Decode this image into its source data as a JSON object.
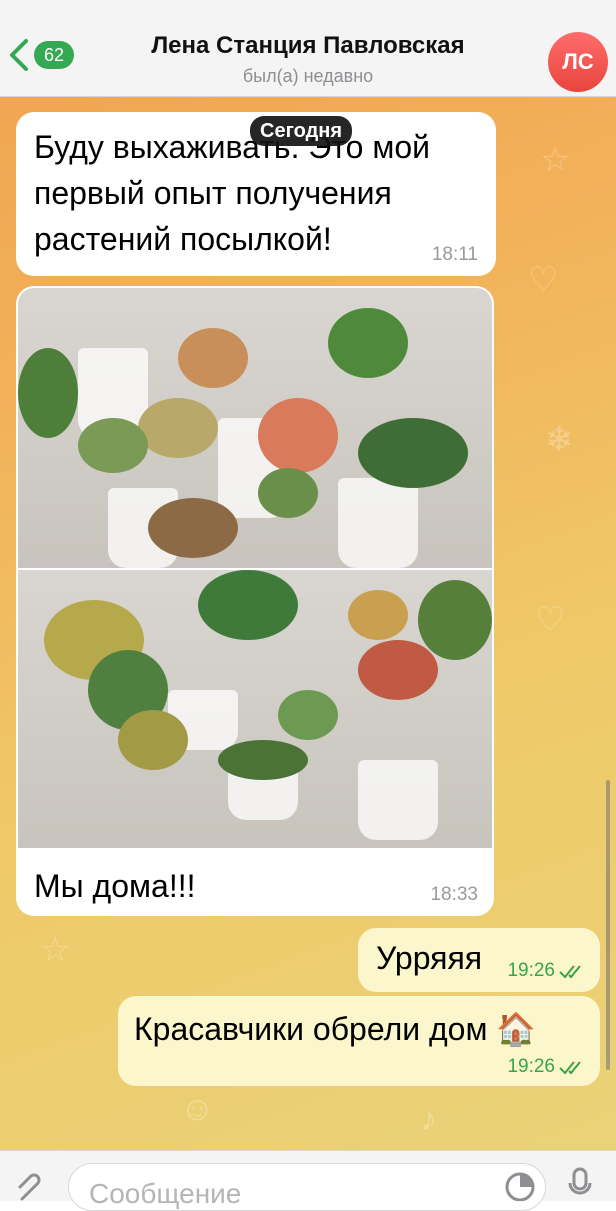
{
  "header": {
    "back_count": "62",
    "title": "Лена Станция Павловская",
    "status": "был(а) недавно",
    "avatar_initials": "ЛС"
  },
  "date_pill": "Сегодня",
  "messages": [
    {
      "direction": "in",
      "text": "Буду выхаживать. Это мой первый опыт получения растений посылкой!",
      "time": "18:11"
    },
    {
      "direction": "in",
      "media": [
        "photo",
        "photo"
      ],
      "text": "Мы дома!!!",
      "time": "18:33"
    },
    {
      "direction": "out",
      "text": "Урряяя",
      "time": "19:26",
      "read": true
    },
    {
      "direction": "out",
      "text": "Красавчики обрели дом 🏠",
      "time": "19:26",
      "read": true
    }
  ],
  "composer": {
    "placeholder": "Сообщение"
  },
  "colors": {
    "accent_green": "#34a853",
    "outgoing_bubble": "#fbf6cc",
    "avatar": "#e8453c"
  },
  "icons": [
    "chevron-left-icon",
    "paperclip-icon",
    "sticker-icon",
    "microphone-icon",
    "double-check-icon"
  ]
}
